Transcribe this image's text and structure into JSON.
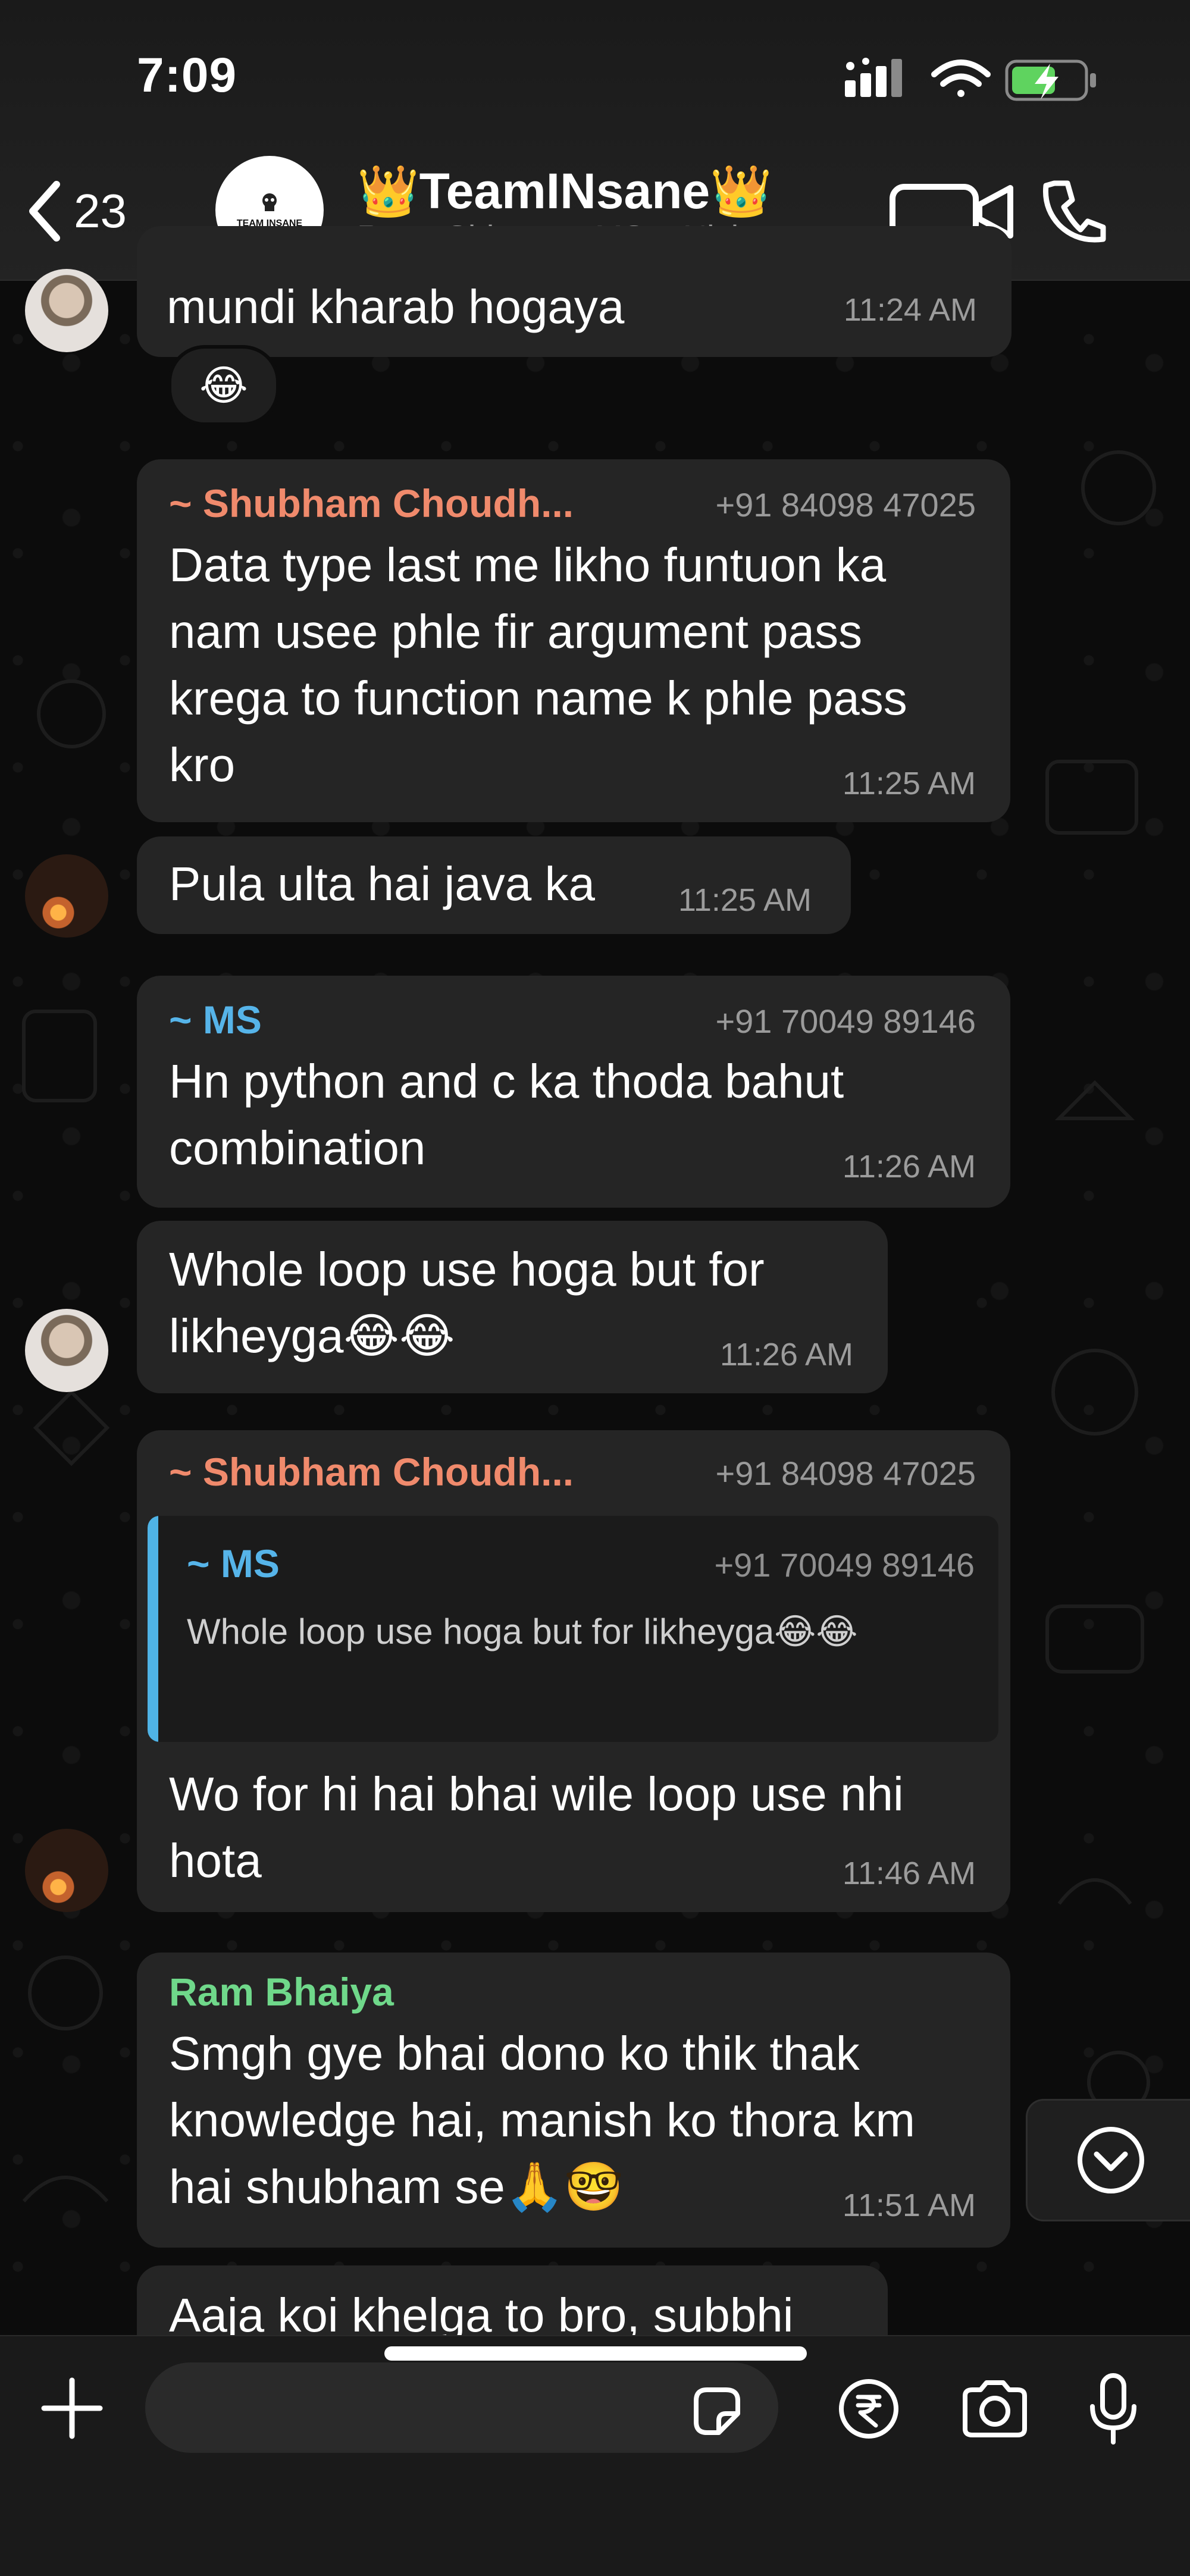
{
  "status_bar": {
    "time": "7:09"
  },
  "header": {
    "back_count": "23",
    "avatar_logo_text": "TEAM INSANE",
    "group_name": "👑TeamINsane👑",
    "members": "Ram, Shivam, ~MS, ~Nishar..."
  },
  "messages": [
    {
      "id": "m1",
      "text_lines": [
        "mundi kharab hogaya"
      ],
      "time": "11:24 AM",
      "reaction": "😂",
      "avatar": "man"
    },
    {
      "id": "m2",
      "sender": "~ Shubham Choudh...",
      "sender_color": "#f08a6c",
      "phone": "+91 84098 47025",
      "text_lines": [
        "Data type last me likho funtuon ka",
        "nam usee phle fir argument pass",
        "krega to function name k phle pass",
        "kro"
      ],
      "time": "11:25 AM"
    },
    {
      "id": "m3",
      "text_lines": [
        "Pula ulta hai java ka"
      ],
      "time": "11:25 AM",
      "avatar": "fire"
    },
    {
      "id": "m4",
      "sender": "~ MS",
      "sender_color": "#56b4e9",
      "phone": "+91 70049 89146",
      "text_lines": [
        "Hn python and c ka thoda bahut",
        "combination"
      ],
      "time": "11:26 AM"
    },
    {
      "id": "m5",
      "text_lines": [
        "Whole loop use hoga but for",
        "likheyga😂😂"
      ],
      "time": "11:26 AM",
      "avatar": "man"
    },
    {
      "id": "m6",
      "sender": "~ Shubham Choudh...",
      "sender_color": "#f08a6c",
      "phone": "+91 84098 47025",
      "quote": {
        "sender": "~ MS",
        "phone": "+91 70049 89146",
        "text": "Whole loop use hoga but for likheyga😂😂"
      },
      "text_lines": [
        "Wo for hi hai bhai wile loop use nhi",
        "hota"
      ],
      "time": "11:46 AM",
      "avatar": "fire"
    },
    {
      "id": "m7",
      "sender": "Ram Bhaiya",
      "sender_color": "#6fd88a",
      "text_lines": [
        "Smgh gye bhai dono ko thik thak",
        "knowledge hai, manish ko thora km",
        "hai shubham se🙏🤓"
      ],
      "time": "11:51 AM"
    },
    {
      "id": "m8",
      "text_lines": [
        "Aaja koi khelga to bro, subbhi"
      ]
    }
  ],
  "icons": {
    "back": "chevron-left-icon",
    "video_call": "video-camera-icon",
    "voice_call": "phone-icon",
    "attach": "plus-icon",
    "sticker": "sticker-icon",
    "payment": "rupee-icon",
    "camera": "camera-icon",
    "mic": "microphone-icon",
    "scroll_down": "chevron-down-circle-icon"
  },
  "colors": {
    "background": "#0c0c0c",
    "bubble": "#252525",
    "time_text": "#9c9c9c"
  }
}
